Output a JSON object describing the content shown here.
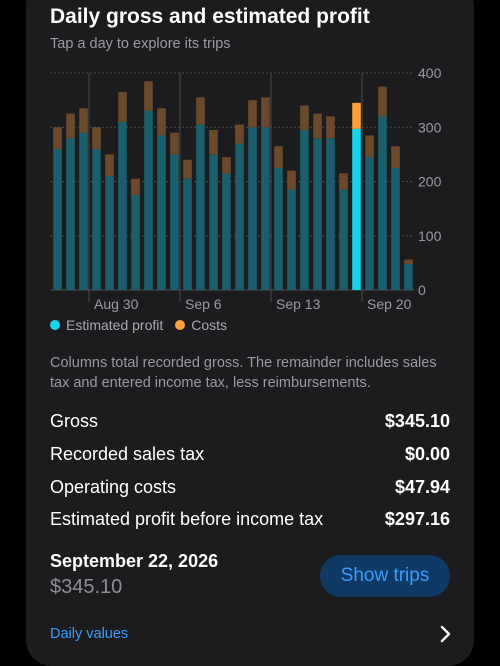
{
  "header": {
    "title": "Daily gross and estimated profit",
    "subtitle": "Tap a day to explore its trips"
  },
  "chart_data": {
    "type": "bar",
    "stacked": true,
    "title": "Daily gross and estimated profit",
    "ylim": [
      0,
      400
    ],
    "y_ticks": [
      "400",
      "300",
      "200",
      "100",
      "0"
    ],
    "x_tick_labels": [
      "Aug 30",
      "Sep 6",
      "Sep 13",
      "Sep 20"
    ],
    "grid": true,
    "legend_position": "bottom-left",
    "selected_index": 36,
    "series": [
      {
        "name": "Estimated profit",
        "color": "#1a5f6b",
        "selected_color": "#19d3ea",
        "values": [
          260,
          280,
          290,
          260,
          210,
          310,
          175,
          330,
          285,
          250,
          205,
          305,
          250,
          215,
          270,
          300,
          300,
          225,
          185,
          295,
          280,
          280,
          185,
          297,
          245,
          320,
          225,
          48
        ]
      },
      {
        "name": "Costs",
        "color": "#6a4a2b",
        "selected_color": "#ff9f3a",
        "values": [
          40,
          45,
          45,
          40,
          40,
          55,
          30,
          55,
          50,
          40,
          35,
          50,
          45,
          30,
          35,
          50,
          55,
          40,
          35,
          45,
          45,
          40,
          30,
          48,
          40,
          55,
          40,
          8
        ]
      }
    ]
  },
  "legend": {
    "profit_label": "Estimated profit",
    "costs_label": "Costs",
    "profit_color": "#19d3ea",
    "costs_color": "#ff9f3a"
  },
  "note": "Columns total recorded gross. The remainder includes sales tax and entered income tax, less reimbursements.",
  "breakdown": [
    {
      "label": "Gross",
      "value": "$345.10"
    },
    {
      "label": "Recorded sales tax",
      "value": "$0.00"
    },
    {
      "label": "Operating costs",
      "value": "$47.94"
    },
    {
      "label": "Estimated profit before income tax",
      "value": "$297.16"
    }
  ],
  "selection": {
    "date": "September 22, 2026",
    "amount": "$345.10",
    "show_trips_label": "Show trips"
  },
  "footer": {
    "daily_values_label": "Daily values"
  }
}
